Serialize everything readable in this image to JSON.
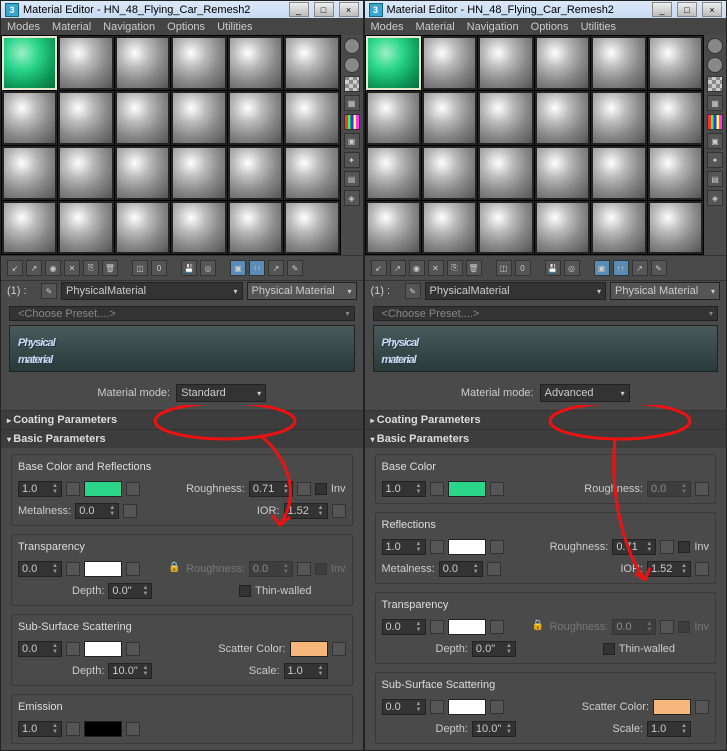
{
  "left": {
    "window_title": "Material Editor - HN_48_Flying_Car_Remesh2",
    "menus": [
      "Modes",
      "Material",
      "Navigation",
      "Options",
      "Utilities"
    ],
    "slot_index": "(1) :",
    "slot_name": "PhysicalMaterial",
    "slot_type": "Physical Material",
    "preset": "<Choose Preset....>",
    "logo_top": "Physical",
    "logo_bot": "material",
    "mode_label": "Material mode:",
    "mode_value": "Standard",
    "rollouts": {
      "coating": "Coating Parameters",
      "basic": "Basic Parameters"
    },
    "basic": {
      "base_grp": "Base Color and Reflections",
      "base_weight": "1.0",
      "base_color": "#2bd68a",
      "roughness_lbl": "Roughness:",
      "roughness": "0.71",
      "inv": "Inv",
      "metalness_lbl": "Metalness:",
      "metalness": "0.0",
      "ior_lbl": "IOR:",
      "ior": "1.52",
      "trans_grp": "Transparency",
      "trans_weight": "0.0",
      "trans_rough": "0.0",
      "depth_lbl": "Depth:",
      "depth": "0.0\"",
      "thin_lbl": "Thin-walled",
      "sss_grp": "Sub-Surface Scattering",
      "sss_weight": "0.0",
      "sss_color": "#ffffff",
      "scatter_lbl": "Scatter Color:",
      "scatter_color": "#f5b87a",
      "sss_depth": "10.0\"",
      "scale_lbl": "Scale:",
      "scale": "1.0",
      "emission_grp": "Emission",
      "emission_weight": "1.0",
      "emission_color": "#000000"
    }
  },
  "right": {
    "window_title": "Material Editor - HN_48_Flying_Car_Remesh2",
    "menus": [
      "Modes",
      "Material",
      "Navigation",
      "Options",
      "Utilities"
    ],
    "slot_index": "(1) :",
    "slot_name": "PhysicalMaterial",
    "slot_type": "Physical Material",
    "preset": "<Choose Preset....>",
    "logo_top": "Physical",
    "logo_bot": "material",
    "mode_label": "Material mode:",
    "mode_value": "Advanced",
    "rollouts": {
      "coating": "Coating Parameters",
      "basic": "Basic Parameters"
    },
    "basic": {
      "base_grp": "Base Color",
      "base_weight": "1.0",
      "base_color": "#2bd68a",
      "roughness_lbl": "Roughness:",
      "base_rough": "0.0",
      "refl_grp": "Reflections",
      "refl_weight": "1.0",
      "refl_color": "#ffffff",
      "refl_rough": "0.71",
      "inv": "Inv",
      "metalness_lbl": "Metalness:",
      "metalness": "0.0",
      "ior_lbl": "IOR:",
      "ior": "1.52",
      "trans_grp": "Transparency",
      "trans_weight": "0.0",
      "trans_rough": "0.0",
      "depth_lbl": "Depth:",
      "depth": "0.0\"",
      "thin_lbl": "Thin-walled",
      "sss_grp": "Sub-Surface Scattering",
      "sss_weight": "0.0",
      "sss_color": "#ffffff",
      "scatter_lbl": "Scatter Color:",
      "scatter_color": "#f5b87a",
      "sss_depth": "10.0\"",
      "scale_lbl": "Scale:",
      "scale": "1.0"
    }
  }
}
